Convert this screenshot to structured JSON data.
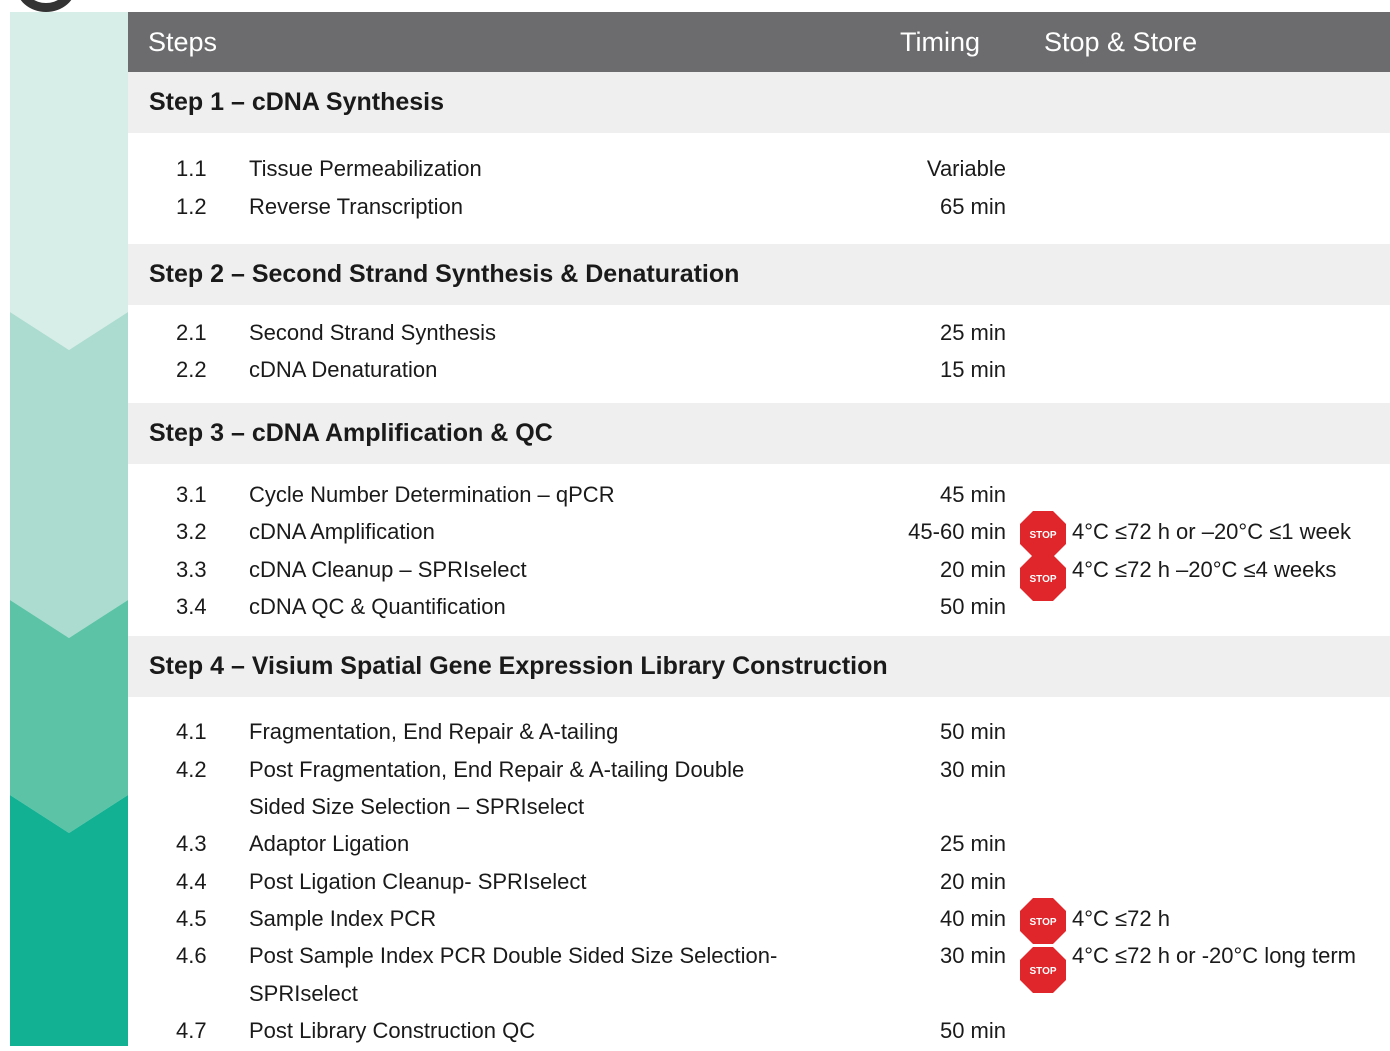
{
  "header": {
    "steps_label": "Steps",
    "timing_label": "Timing",
    "stop_store_label": "Stop & Store"
  },
  "colors": {
    "header_bg": "#6c6c6e",
    "step_band_bg": "#efefef",
    "stop_red": "#e0252b",
    "chevron_shades": [
      "#d7ede8",
      "#acdccf",
      "#5cc3a6",
      "#12b193"
    ]
  },
  "stop_icon": {
    "name": "stop-sign-icon",
    "text": "STOP"
  },
  "steps": [
    {
      "title": "Step 1 – cDNA Synthesis",
      "items": [
        {
          "num": "1.1",
          "label": "Tissue Permeabilization",
          "timing": "Variable",
          "stop": ""
        },
        {
          "num": "1.2",
          "label": "Reverse Transcription",
          "timing": "65 min",
          "stop": ""
        }
      ]
    },
    {
      "title": "Step 2 – Second Strand Synthesis & Denaturation",
      "items": [
        {
          "num": "2.1",
          "label": "Second Strand Synthesis",
          "timing": "25 min",
          "stop": ""
        },
        {
          "num": "2.2",
          "label": "cDNA Denaturation",
          "timing": "15 min",
          "stop": ""
        }
      ]
    },
    {
      "title": "Step 3 – cDNA Amplification & QC",
      "items": [
        {
          "num": "3.1",
          "label": "Cycle Number Determination – qPCR",
          "timing": "45 min",
          "stop": ""
        },
        {
          "num": "3.2",
          "label": "cDNA Amplification",
          "timing": "45-60 min",
          "stop": "4°C ≤72 h or –20°C ≤1 week"
        },
        {
          "num": "3.3",
          "label": "cDNA Cleanup – SPRIselect",
          "timing": "20 min",
          "stop": "4°C ≤72 h –20°C ≤4 weeks"
        },
        {
          "num": "3.4",
          "label": "cDNA QC & Quantification",
          "timing": "50 min",
          "stop": ""
        }
      ]
    },
    {
      "title": "Step 4 – Visium Spatial Gene Expression Library Construction",
      "items": [
        {
          "num": "4.1",
          "label": "Fragmentation, End Repair & A-tailing",
          "timing": "50 min",
          "stop": ""
        },
        {
          "num": "4.2",
          "label": "Post Fragmentation, End Repair & A-tailing Double",
          "label2": "Sided Size Selection – SPRIselect",
          "timing": "30 min",
          "stop": ""
        },
        {
          "num": "4.3",
          "label": "Adaptor Ligation",
          "timing": "25 min",
          "stop": ""
        },
        {
          "num": "4.4",
          "label": "Post Ligation Cleanup- SPRIselect",
          "timing": "20 min",
          "stop": ""
        },
        {
          "num": "4.5",
          "label": "Sample Index PCR",
          "timing": "40 min",
          "stop": "4°C ≤72 h"
        },
        {
          "num": "4.6",
          "label": "Post Sample Index PCR Double Sided Size Selection-",
          "label2": "SPRIselect",
          "timing": "30 min",
          "stop": "4°C ≤72 h or -20°C long term"
        },
        {
          "num": "4.7",
          "label": "Post Library Construction QC",
          "timing": "50  min",
          "stop": ""
        }
      ]
    }
  ]
}
